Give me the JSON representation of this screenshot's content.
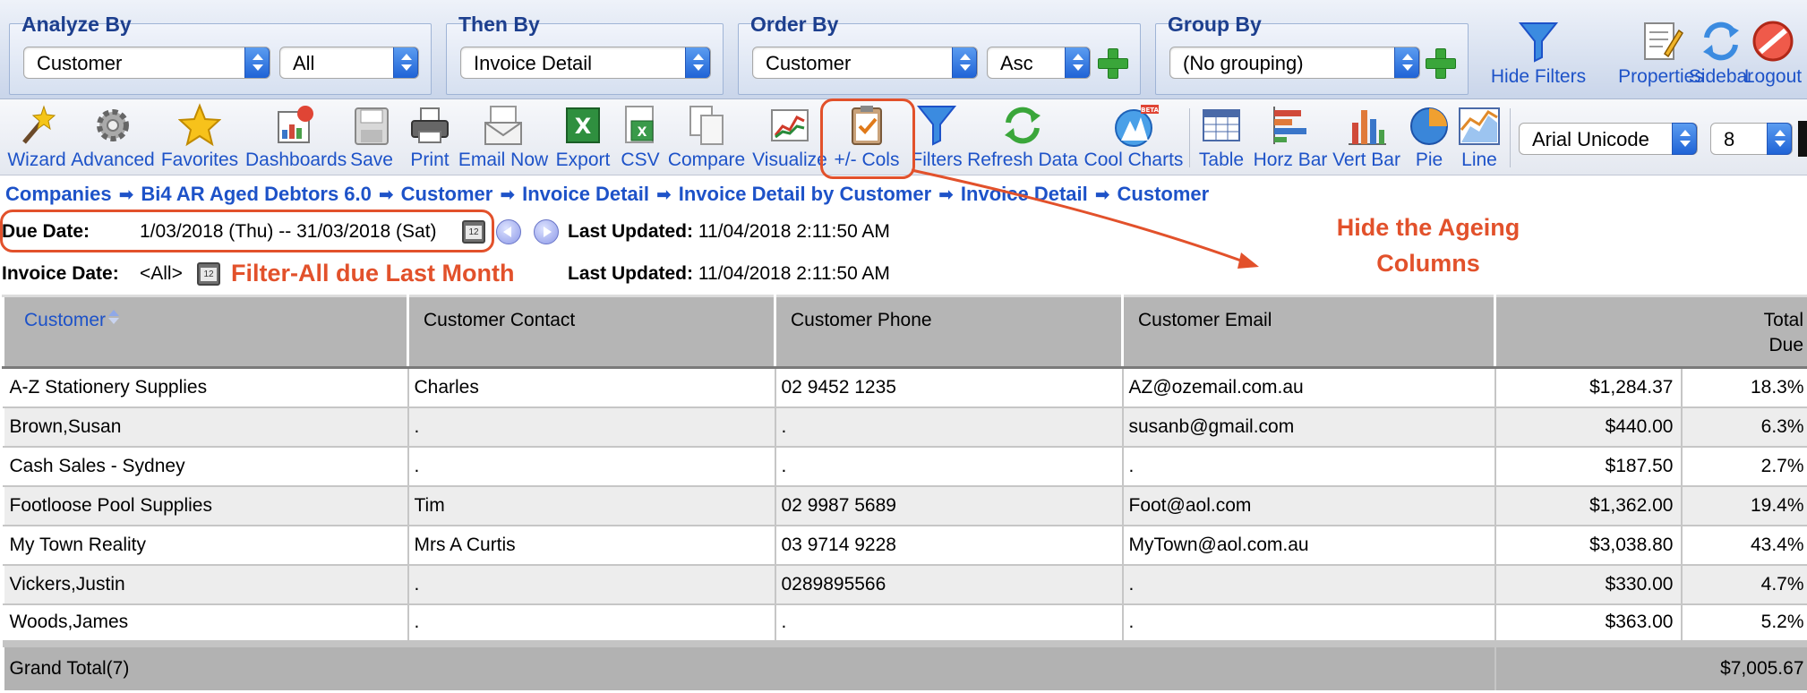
{
  "filters": {
    "analyze_by": {
      "title": "Analyze By",
      "value": "Customer",
      "scope": "All"
    },
    "then_by": {
      "title": "Then By",
      "value": "Invoice Detail"
    },
    "order_by": {
      "title": "Order By",
      "value": "Customer",
      "direction": "Asc"
    },
    "group_by": {
      "title": "Group By",
      "value": "(No grouping)"
    }
  },
  "top_buttons": {
    "hide_filters": "Hide Filters",
    "properties": "Properties",
    "sidebar": "Sidebar",
    "logout": "Logout"
  },
  "toolbar": {
    "wizard": "Wizard",
    "advanced": "Advanced",
    "favorites": "Favorites",
    "dashboards": "Dashboards",
    "save": "Save",
    "print": "Print",
    "email_now": "Email Now",
    "export": "Export",
    "csv": "CSV",
    "compare": "Compare",
    "visualize": "Visualize",
    "cols": "+/- Cols",
    "filters": "Filters",
    "refresh": "Refresh Data",
    "cool_charts": "Cool Charts",
    "cool_badge": "BETA",
    "table": "Table",
    "horz_bar": "Horz Bar",
    "vert_bar": "Vert Bar",
    "pie": "Pie",
    "line": "Line",
    "font": "Arial Unicode",
    "font_size": "8"
  },
  "breadcrumb": [
    "Companies",
    "Bi4 AR Aged Debtors 6.0",
    "Customer",
    "Invoice Detail",
    "Invoice Detail by Customer",
    "Invoice Detail",
    "Customer"
  ],
  "due_filter": {
    "label": "Due Date:",
    "value": "1/03/2018 (Thu) -- 31/03/2018 (Sat)",
    "updated_label": "Last Updated:",
    "updated_value": "11/04/2018 2:11:50 AM"
  },
  "invoice_filter": {
    "label": "Invoice Date:",
    "value": "<All>",
    "updated_label": "Last Updated:",
    "updated_value": "11/04/2018 2:11:50 AM"
  },
  "annotations": {
    "filter_note": "Filter-All due Last Month",
    "hide_line1": "Hide the Ageing",
    "hide_line2": "Columns"
  },
  "grid": {
    "headers": {
      "customer": "Customer",
      "contact": "Customer Contact",
      "phone": "Customer Phone",
      "email": "Customer Email",
      "total_line1": "Total",
      "total_line2": "Due"
    },
    "rows": [
      {
        "customer": "A-Z Stationery Supplies",
        "contact": "Charles",
        "phone": "02 9452 1235",
        "email": "AZ@ozemail.com.au",
        "total": "$1,284.37",
        "pct": "18.3%"
      },
      {
        "customer": "Brown,Susan",
        "contact": ".",
        "phone": ".",
        "email": "susanb@gmail.com",
        "total": "$440.00",
        "pct": "6.3%"
      },
      {
        "customer": "Cash Sales - Sydney",
        "contact": ".",
        "phone": ".",
        "email": ".",
        "total": "$187.50",
        "pct": "2.7%"
      },
      {
        "customer": "Footloose Pool Supplies",
        "contact": "Tim",
        "phone": "02 9987 5689",
        "email": "Foot@aol.com",
        "total": "$1,362.00",
        "pct": "19.4%"
      },
      {
        "customer": "My Town Reality",
        "contact": "Mrs A Curtis",
        "phone": "03 9714 9228",
        "email": "MyTown@aol.com.au",
        "total": "$3,038.80",
        "pct": "43.4%"
      },
      {
        "customer": "Vickers,Justin",
        "contact": ".",
        "phone": "0289895566",
        "email": ".",
        "total": "$330.00",
        "pct": "4.7%"
      },
      {
        "customer": "Woods,James",
        "contact": ".",
        "phone": ".",
        "email": ".",
        "total": "$363.00",
        "pct": "5.2%"
      }
    ],
    "grand_total": {
      "label": "Grand Total(7)",
      "value": "$7,005.67"
    }
  },
  "colors": {
    "accent_blue": "#1d52c8",
    "annotation": "#e2512b",
    "header_gray": "#b5b5b5"
  }
}
